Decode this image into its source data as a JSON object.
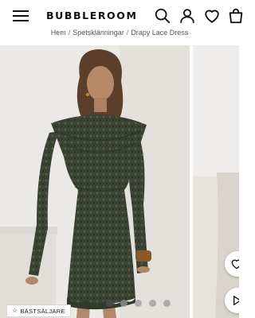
{
  "header": {
    "logo": "BUBBLEROOM",
    "icons": [
      "menu-icon",
      "search-icon",
      "user-icon",
      "heart-icon",
      "bag-icon"
    ]
  },
  "breadcrumb": {
    "items": [
      "Hem",
      "Spetsklänningar",
      "Drapy Lace Dress"
    ],
    "separator": "/"
  },
  "gallery": {
    "badge_label": "BÄSTSÄLJARE",
    "badge_icon": "star-icon",
    "image_count": 5,
    "active_index": 0,
    "side_buttons": [
      "heart-icon",
      "play-icon"
    ]
  },
  "colors": {
    "dress": "#3a4232",
    "background": "#ebe9e6",
    "text": "#111111"
  }
}
